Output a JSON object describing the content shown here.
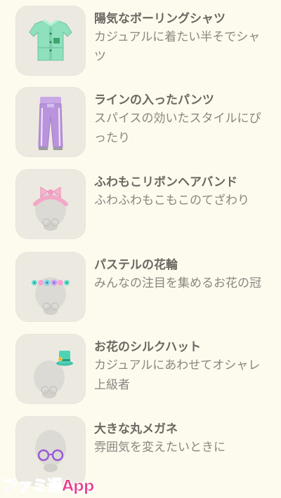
{
  "items": [
    {
      "name": "陽気なボーリングシャツ",
      "desc": "カジュアルに着たい半そでシャツ",
      "icon": "bowling-shirt-icon"
    },
    {
      "name": "ラインの入ったパンツ",
      "desc": "スパイスの効いたスタイルにぴったり",
      "icon": "pants-icon"
    },
    {
      "name": "ふわもこリボンヘアバンド",
      "desc": "ふわふわもこもこのてざわり",
      "icon": "ribbon-headband-icon"
    },
    {
      "name": "パステルの花輪",
      "desc": "みんなの注目を集めるお花の冠",
      "icon": "flower-crown-icon"
    },
    {
      "name": "お花のシルクハット",
      "desc": "カジュアルにあわせてオシャレ上級者",
      "icon": "silk-hat-icon"
    },
    {
      "name": "大きな丸メガネ",
      "desc": "雰囲気を変えたいときに",
      "icon": "round-glasses-icon"
    }
  ],
  "watermark": "ファミ通App",
  "colors": {
    "background": "#fdfbee",
    "tile": "#ece9e0",
    "title": "#6b6762",
    "description": "#8a8681",
    "watermark": "#e83e8c"
  }
}
